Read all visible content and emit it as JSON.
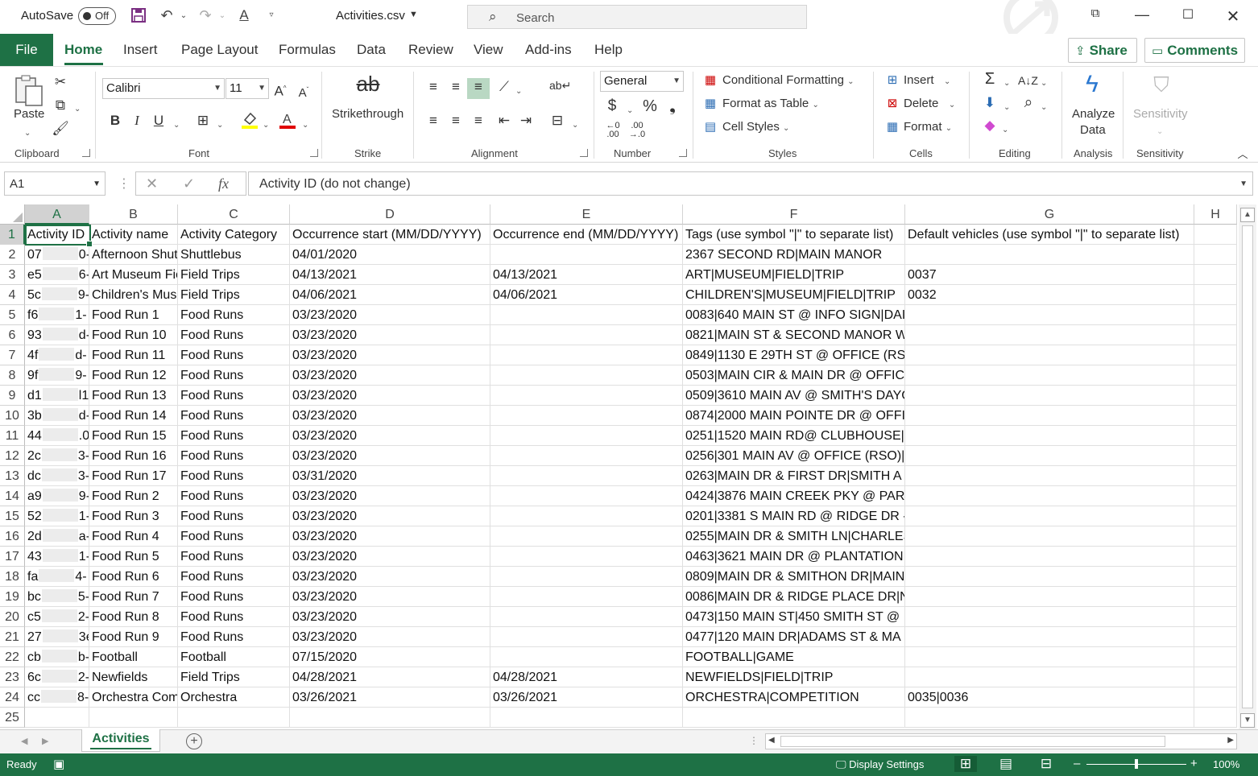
{
  "titlebar": {
    "autosave_label": "AutoSave",
    "autosave_state": "Off",
    "filename": "Activities.csv",
    "search_placeholder": "Search"
  },
  "tabs": {
    "file": "File",
    "items": [
      "Home",
      "Insert",
      "Page Layout",
      "Formulas",
      "Data",
      "Review",
      "View",
      "Add-ins",
      "Help"
    ],
    "share": "Share",
    "comments": "Comments"
  },
  "ribbon": {
    "clipboard": {
      "paste": "Paste",
      "label": "Clipboard"
    },
    "font": {
      "name": "Calibri",
      "size": "11",
      "label": "Font"
    },
    "strike": {
      "button": "Strikethrough",
      "label": "Strike"
    },
    "alignment": {
      "label": "Alignment"
    },
    "number": {
      "format": "General",
      "label": "Number"
    },
    "styles": {
      "conditional": "Conditional Formatting",
      "format_table": "Format as Table",
      "cell_styles": "Cell Styles",
      "label": "Styles"
    },
    "cells": {
      "insert": "Insert",
      "delete": "Delete",
      "format": "Format",
      "label": "Cells"
    },
    "editing": {
      "label": "Editing"
    },
    "analysis": {
      "button_line1": "Analyze",
      "button_line2": "Data",
      "label": "Analysis"
    },
    "sensitivity": {
      "button": "Sensitivity",
      "label": "Sensitivity"
    }
  },
  "formula_bar": {
    "name_box": "A1",
    "fx": "fx",
    "content": "Activity ID (do not change)"
  },
  "columns": [
    "A",
    "B",
    "C",
    "D",
    "E",
    "F",
    "G",
    "H"
  ],
  "rows": [
    [
      "Activity ID (do not change)",
      "Activity name",
      "Activity Category",
      "Occurrence start (MM/DD/YYYY)",
      "Occurrence end (MM/DD/YYYY)",
      "Tags (use symbol \"|\" to separate list)",
      "Default vehicles (use symbol \"|\" to separate list)"
    ],
    [
      "07|0-",
      "Afternoon Shuttle",
      "Shuttlebus",
      "04/01/2020",
      "",
      "2367 SECOND RD|MAIN MANOR",
      ""
    ],
    [
      "e5|6-",
      "Art Museum Field Trip",
      "Field Trips",
      "04/13/2021",
      "04/13/2021",
      "ART|MUSEUM|FIELD|TRIP",
      "0037"
    ],
    [
      "5c|9-",
      "Children's Museum Field Trip",
      "Field Trips",
      "04/06/2021",
      "04/06/2021",
      "CHILDREN'S|MUSEUM|FIELD|TRIP",
      "0032"
    ],
    [
      "f6|1-",
      "Food Run 1",
      "Food Runs",
      "03/23/2020",
      "",
      "0083|640 MAIN ST @ INFO SIGN|DAI",
      ""
    ],
    [
      "93|d-",
      "Food Run 10",
      "Food Runs",
      "03/23/2020",
      "",
      "0821|MAIN ST & SECOND MANOR W",
      ""
    ],
    [
      "4f|d-",
      "Food Run 11",
      "Food Runs",
      "03/23/2020",
      "",
      "0849|1130 E 29TH ST @ OFFICE (RSO",
      ""
    ],
    [
      "9f|9-",
      "Food Run 12",
      "Food Runs",
      "03/23/2020",
      "",
      "0503|MAIN CIR & MAIN DR @ OFFICI",
      ""
    ],
    [
      "d1|l1-",
      "Food Run 13",
      "Food Runs",
      "03/23/2020",
      "",
      "0509|3610 MAIN AV @ SMITH'S DAYC",
      ""
    ],
    [
      "3b|d-",
      "Food Run 14",
      "Food Runs",
      "03/23/2020",
      "",
      "0874|2000 MAIN POINTE DR @ OFFIC",
      ""
    ],
    [
      "44|.0-",
      "Food Run 15",
      "Food Runs",
      "03/23/2020",
      "",
      "0251|1520 MAIN RD@ CLUBHOUSE|",
      ""
    ],
    [
      "2c|3-",
      "Food Run 16",
      "Food Runs",
      "03/23/2020",
      "",
      "0256|301 MAIN AV @ OFFICE (RSO)|S",
      ""
    ],
    [
      "dc|3-",
      "Food Run 17",
      "Food Runs",
      "03/31/2020",
      "",
      "0263|MAIN DR & FIRST DR|SMITH A I",
      ""
    ],
    [
      "a9|9-",
      "Food Run 2",
      "Food Runs",
      "03/23/2020",
      "",
      "0424|3876 MAIN CREEK PKY @ PARKS",
      ""
    ],
    [
      "52|1-",
      "Food Run 3",
      "Food Runs",
      "03/23/2020",
      "",
      "0201|3381 S MAIN RD @ RIDGE DR -",
      ""
    ],
    [
      "2d|a-",
      "Food Run 4",
      "Food Runs",
      "03/23/2020",
      "",
      "0255|MAIN DR & SMITH LN|CHARLES",
      ""
    ],
    [
      "43|1-8",
      "Food Run 5",
      "Food Runs",
      "03/23/2020",
      "",
      "0463|3621 MAIN DR @ PLANTATION",
      ""
    ],
    [
      "fa|4-",
      "Food Run 6",
      "Food Runs",
      "03/23/2020",
      "",
      "0809|MAIN DR & SMITHON DR|MAIN",
      ""
    ],
    [
      "bc|5-",
      "Food Run 7",
      "Food Runs",
      "03/23/2020",
      "",
      "0086|MAIN DR & RIDGE PLACE DR|N",
      ""
    ],
    [
      "c5|2-",
      "Food Run 8",
      "Food Runs",
      "03/23/2020",
      "",
      "0473|150 MAIN ST|450 SMITH ST @",
      ""
    ],
    [
      "27|3e-",
      "Food Run 9",
      "Food Runs",
      "03/23/2020",
      "",
      "0477|120 MAIN DR|ADAMS ST & MA",
      ""
    ],
    [
      "cb|b-",
      "Football",
      "Football",
      "07/15/2020",
      "",
      "FOOTBALL|GAME",
      ""
    ],
    [
      "6c|2-",
      "Newfields",
      "Field Trips",
      "04/28/2021",
      "04/28/2021",
      "NEWFIELDS|FIELD|TRIP",
      ""
    ],
    [
      "cc|8-",
      "Orchestra Competition",
      "Orchestra",
      "03/26/2021",
      "03/26/2021",
      "ORCHESTRA|COMPETITION",
      "0035|0036"
    ],
    [
      "",
      "",
      "",
      "",
      "",
      "",
      ""
    ]
  ],
  "sheet": {
    "tab": "Activities"
  },
  "status": {
    "ready": "Ready",
    "display_settings": "Display Settings",
    "zoom": "100%",
    "zoom_level": 1.0
  },
  "colors": {
    "accent": "#1e7145"
  }
}
